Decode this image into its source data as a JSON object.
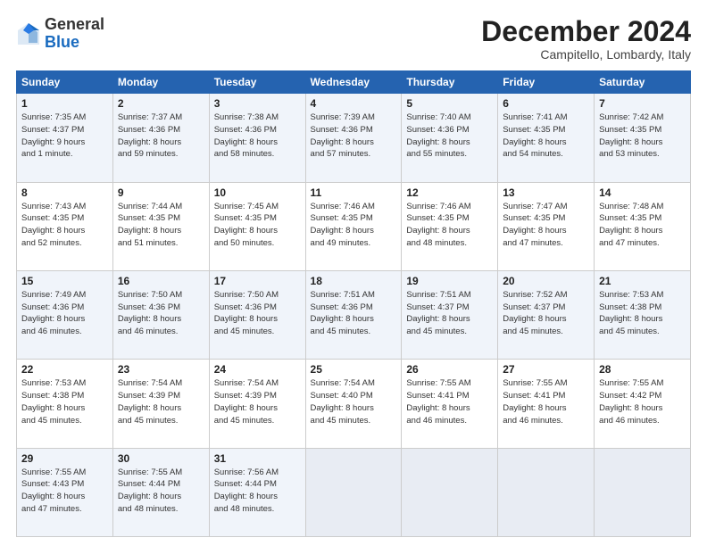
{
  "header": {
    "logo_general": "General",
    "logo_blue": "Blue",
    "title": "December 2024",
    "location": "Campitello, Lombardy, Italy"
  },
  "days_of_week": [
    "Sunday",
    "Monday",
    "Tuesday",
    "Wednesday",
    "Thursday",
    "Friday",
    "Saturday"
  ],
  "weeks": [
    [
      {
        "day": "1",
        "info": "Sunrise: 7:35 AM\nSunset: 4:37 PM\nDaylight: 9 hours\nand 1 minute."
      },
      {
        "day": "2",
        "info": "Sunrise: 7:37 AM\nSunset: 4:36 PM\nDaylight: 8 hours\nand 59 minutes."
      },
      {
        "day": "3",
        "info": "Sunrise: 7:38 AM\nSunset: 4:36 PM\nDaylight: 8 hours\nand 58 minutes."
      },
      {
        "day": "4",
        "info": "Sunrise: 7:39 AM\nSunset: 4:36 PM\nDaylight: 8 hours\nand 57 minutes."
      },
      {
        "day": "5",
        "info": "Sunrise: 7:40 AM\nSunset: 4:36 PM\nDaylight: 8 hours\nand 55 minutes."
      },
      {
        "day": "6",
        "info": "Sunrise: 7:41 AM\nSunset: 4:35 PM\nDaylight: 8 hours\nand 54 minutes."
      },
      {
        "day": "7",
        "info": "Sunrise: 7:42 AM\nSunset: 4:35 PM\nDaylight: 8 hours\nand 53 minutes."
      }
    ],
    [
      {
        "day": "8",
        "info": "Sunrise: 7:43 AM\nSunset: 4:35 PM\nDaylight: 8 hours\nand 52 minutes."
      },
      {
        "day": "9",
        "info": "Sunrise: 7:44 AM\nSunset: 4:35 PM\nDaylight: 8 hours\nand 51 minutes."
      },
      {
        "day": "10",
        "info": "Sunrise: 7:45 AM\nSunset: 4:35 PM\nDaylight: 8 hours\nand 50 minutes."
      },
      {
        "day": "11",
        "info": "Sunrise: 7:46 AM\nSunset: 4:35 PM\nDaylight: 8 hours\nand 49 minutes."
      },
      {
        "day": "12",
        "info": "Sunrise: 7:46 AM\nSunset: 4:35 PM\nDaylight: 8 hours\nand 48 minutes."
      },
      {
        "day": "13",
        "info": "Sunrise: 7:47 AM\nSunset: 4:35 PM\nDaylight: 8 hours\nand 47 minutes."
      },
      {
        "day": "14",
        "info": "Sunrise: 7:48 AM\nSunset: 4:35 PM\nDaylight: 8 hours\nand 47 minutes."
      }
    ],
    [
      {
        "day": "15",
        "info": "Sunrise: 7:49 AM\nSunset: 4:36 PM\nDaylight: 8 hours\nand 46 minutes."
      },
      {
        "day": "16",
        "info": "Sunrise: 7:50 AM\nSunset: 4:36 PM\nDaylight: 8 hours\nand 46 minutes."
      },
      {
        "day": "17",
        "info": "Sunrise: 7:50 AM\nSunset: 4:36 PM\nDaylight: 8 hours\nand 45 minutes."
      },
      {
        "day": "18",
        "info": "Sunrise: 7:51 AM\nSunset: 4:36 PM\nDaylight: 8 hours\nand 45 minutes."
      },
      {
        "day": "19",
        "info": "Sunrise: 7:51 AM\nSunset: 4:37 PM\nDaylight: 8 hours\nand 45 minutes."
      },
      {
        "day": "20",
        "info": "Sunrise: 7:52 AM\nSunset: 4:37 PM\nDaylight: 8 hours\nand 45 minutes."
      },
      {
        "day": "21",
        "info": "Sunrise: 7:53 AM\nSunset: 4:38 PM\nDaylight: 8 hours\nand 45 minutes."
      }
    ],
    [
      {
        "day": "22",
        "info": "Sunrise: 7:53 AM\nSunset: 4:38 PM\nDaylight: 8 hours\nand 45 minutes."
      },
      {
        "day": "23",
        "info": "Sunrise: 7:54 AM\nSunset: 4:39 PM\nDaylight: 8 hours\nand 45 minutes."
      },
      {
        "day": "24",
        "info": "Sunrise: 7:54 AM\nSunset: 4:39 PM\nDaylight: 8 hours\nand 45 minutes."
      },
      {
        "day": "25",
        "info": "Sunrise: 7:54 AM\nSunset: 4:40 PM\nDaylight: 8 hours\nand 45 minutes."
      },
      {
        "day": "26",
        "info": "Sunrise: 7:55 AM\nSunset: 4:41 PM\nDaylight: 8 hours\nand 46 minutes."
      },
      {
        "day": "27",
        "info": "Sunrise: 7:55 AM\nSunset: 4:41 PM\nDaylight: 8 hours\nand 46 minutes."
      },
      {
        "day": "28",
        "info": "Sunrise: 7:55 AM\nSunset: 4:42 PM\nDaylight: 8 hours\nand 46 minutes."
      }
    ],
    [
      {
        "day": "29",
        "info": "Sunrise: 7:55 AM\nSunset: 4:43 PM\nDaylight: 8 hours\nand 47 minutes."
      },
      {
        "day": "30",
        "info": "Sunrise: 7:55 AM\nSunset: 4:44 PM\nDaylight: 8 hours\nand 48 minutes."
      },
      {
        "day": "31",
        "info": "Sunrise: 7:56 AM\nSunset: 4:44 PM\nDaylight: 8 hours\nand 48 minutes."
      },
      null,
      null,
      null,
      null
    ]
  ]
}
